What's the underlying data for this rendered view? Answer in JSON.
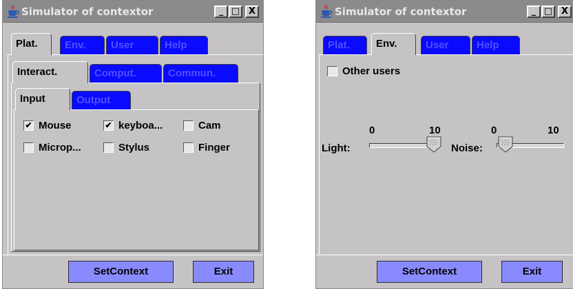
{
  "window_platform": {
    "title": "Simulator of contextor",
    "controls": {
      "minimize": "_",
      "maximize": "□",
      "close": "X"
    },
    "main_tabs": [
      "Plat.",
      "Env.",
      "User",
      "Help"
    ],
    "selected_main_tab": "Plat.",
    "sub_tabs": [
      "Interact.",
      "Comput.",
      "Commun."
    ],
    "selected_sub_tab": "Interact.",
    "io_tabs": [
      "Input",
      "Output"
    ],
    "selected_io_tab": "Input",
    "inputs": [
      {
        "label": "Mouse",
        "checked": true
      },
      {
        "label": "keyboa...",
        "checked": true
      },
      {
        "label": "Cam",
        "checked": false
      },
      {
        "label": "Microp...",
        "checked": false
      },
      {
        "label": "Stylus",
        "checked": false
      },
      {
        "label": "Finger",
        "checked": false
      }
    ],
    "buttons": {
      "set_context": "SetContext",
      "exit": "Exit"
    }
  },
  "window_environment": {
    "title": "Simulator of contextor",
    "controls": {
      "minimize": "_",
      "maximize": "□",
      "close": "X"
    },
    "main_tabs": [
      "Plat.",
      "Env.",
      "User",
      "Help"
    ],
    "selected_main_tab": "Env.",
    "other_users": {
      "label": "Other users",
      "checked": false
    },
    "light": {
      "label": "Light:",
      "min_label": "0",
      "max_label": "10",
      "value": 10
    },
    "noise": {
      "label": "Noise:",
      "min_label": "0",
      "max_label": "10",
      "value": 0
    },
    "buttons": {
      "set_context": "SetContext",
      "exit": "Exit"
    }
  },
  "colors": {
    "tab_blue": "#0a0aff",
    "button_blue": "#8a8aff",
    "panel_gray": "#c6c3c6",
    "titlebar_inactive": "#8c8a8c"
  }
}
